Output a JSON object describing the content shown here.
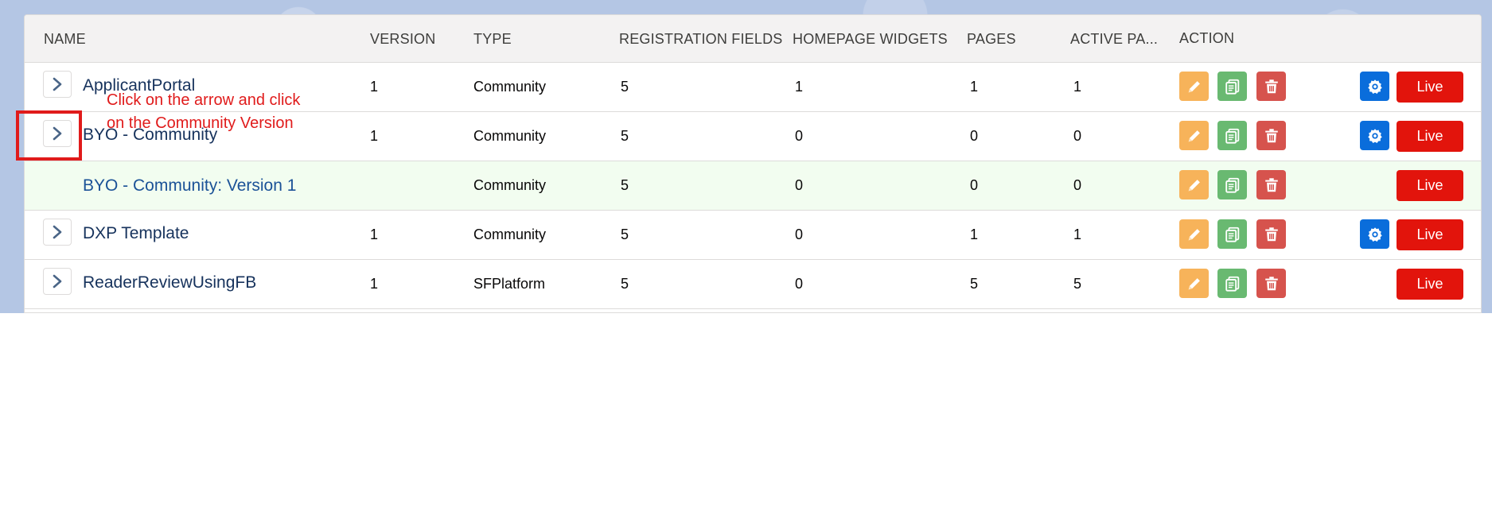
{
  "columns": {
    "name": "NAME",
    "version": "VERSION",
    "type": "TYPE",
    "registration_fields": "REGISTRATION FIELDS",
    "homepage_widgets": "HOMEPAGE WIDGETS",
    "pages": "PAGES",
    "active_pages": "ACTIVE PA...",
    "action": "ACTION"
  },
  "rows": [
    {
      "name": "ApplicantPortal",
      "version": "1",
      "type": "Community",
      "registration_fields": "5",
      "homepage_widgets": "1",
      "pages": "1",
      "active_pages": "1",
      "live_label": "Live",
      "has_settings": true
    },
    {
      "name": "BYO - Community",
      "version": "1",
      "type": "Community",
      "registration_fields": "5",
      "homepage_widgets": "0",
      "pages": "0",
      "active_pages": "0",
      "live_label": "Live",
      "has_settings": true
    },
    {
      "name": "BYO - Community: Version 1",
      "version": "",
      "type": "Community",
      "registration_fields": "5",
      "homepage_widgets": "0",
      "pages": "0",
      "active_pages": "0",
      "live_label": "Live",
      "has_settings": false
    },
    {
      "name": "DXP Template",
      "version": "1",
      "type": "Community",
      "registration_fields": "5",
      "homepage_widgets": "0",
      "pages": "1",
      "active_pages": "1",
      "live_label": "Live",
      "has_settings": true
    },
    {
      "name": "ReaderReviewUsingFB",
      "version": "1",
      "type": "SFPlatform",
      "registration_fields": "5",
      "homepage_widgets": "0",
      "pages": "5",
      "active_pages": "5",
      "live_label": "Live",
      "has_settings": false
    }
  ],
  "annotation": {
    "text": "Click on the arrow and click on the Community Version",
    "color": "#e01b1b"
  },
  "icons": {
    "expand": "chevron-right-icon",
    "edit": "pencil-icon",
    "copy": "copy-icon",
    "delete": "trash-icon",
    "settings": "gear-icon"
  },
  "colors": {
    "edit": "#f7b35a",
    "copy": "#69b971",
    "delete": "#d6534d",
    "settings": "#0a6ddb",
    "live": "#e2140c",
    "version_row": "#f2fdf0"
  }
}
